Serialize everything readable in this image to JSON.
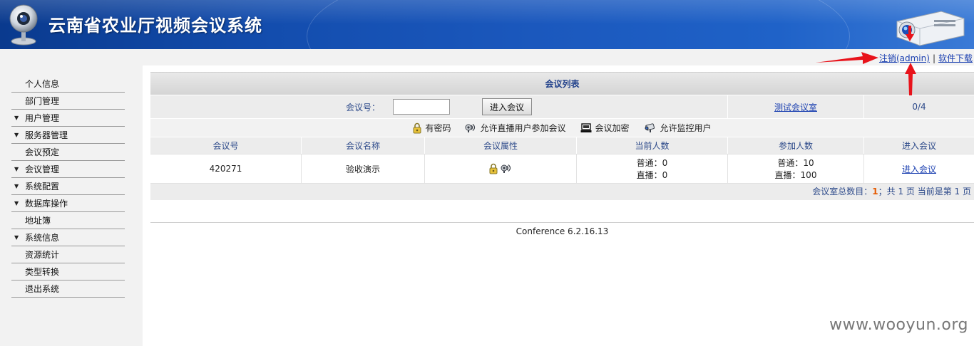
{
  "header": {
    "title": "云南省农业厅视频会议系统"
  },
  "toplinks": {
    "logout": "注销(admin)",
    "separator": "|",
    "download": "软件下载"
  },
  "sidebar": {
    "items": [
      {
        "label": "个人信息",
        "expandable": false
      },
      {
        "label": "部门管理",
        "expandable": false
      },
      {
        "label": "用户管理",
        "expandable": true
      },
      {
        "label": "服务器管理",
        "expandable": true
      },
      {
        "label": "会议预定",
        "expandable": false
      },
      {
        "label": "会议管理",
        "expandable": true
      },
      {
        "label": "系统配置",
        "expandable": true
      },
      {
        "label": "数据库操作",
        "expandable": true
      },
      {
        "label": "地址簿",
        "expandable": false
      },
      {
        "label": "系统信息",
        "expandable": true
      },
      {
        "label": "资源统计",
        "expandable": false
      },
      {
        "label": "类型转换",
        "expandable": false
      },
      {
        "label": "退出系统",
        "expandable": false
      }
    ]
  },
  "conference_list": {
    "title": "会议列表",
    "join": {
      "label": "会议号：",
      "input_value": "",
      "button": "进入会议",
      "test_room_link": "测试会议室",
      "room_usage": "0/4"
    },
    "legend": [
      {
        "icon": "lock-icon",
        "label": "有密码"
      },
      {
        "icon": "broadcast-icon",
        "label": "允许直播用户参加会议"
      },
      {
        "icon": "encrypt-icon",
        "label": "会议加密"
      },
      {
        "icon": "camera-icon",
        "label": "允许监控用户"
      }
    ],
    "columns": [
      "会议号",
      "会议名称",
      "会议属性",
      "当前人数",
      "参加人数",
      "进入会议"
    ],
    "rows": [
      {
        "id": "420271",
        "name": "验收演示",
        "attribute_icons": [
          "lock-icon",
          "broadcast-icon"
        ],
        "current_normal": "普通：0",
        "current_live": "直播：0",
        "joined_normal": "普通：10",
        "joined_live": "直播：100",
        "enter_link": "进入会议"
      }
    ],
    "footer": {
      "prefix": "会议室总数目：",
      "count": "1",
      "suffix": "；共 1 页 当前是第 1 页"
    }
  },
  "version": "Conference 6.2.16.13",
  "watermark": "www.wooyun.org",
  "colors": {
    "header_blue": "#1b58bd",
    "link_blue": "#1a3fb0",
    "label_blue": "#2d4a8a",
    "annotation_red": "#e8131b",
    "count_orange": "#e65a00"
  }
}
